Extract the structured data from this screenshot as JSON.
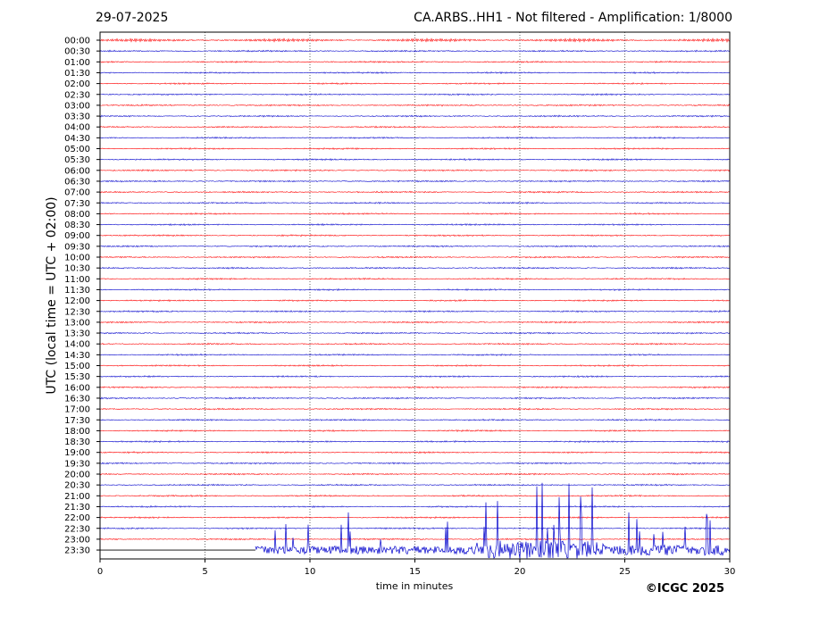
{
  "header": {
    "date": "29-07-2025",
    "title": "CA.ARBS..HH1 - Not filtered - Amplification: 1/8000"
  },
  "footer": {
    "copyright": "©ICGC 2025"
  },
  "chart_data": {
    "type": "line",
    "title": "CA.ARBS..HH1 - Not filtered - Amplification: 1/8000",
    "date": "29-07-2025",
    "xlabel": "time in minutes",
    "ylabel": "UTC (local time = UTC + 02:00)",
    "xlim": [
      0,
      30
    ],
    "x_ticks": [
      0,
      5,
      10,
      15,
      20,
      25,
      30
    ],
    "y_ticks": [
      "00:00",
      "00:30",
      "01:00",
      "01:30",
      "02:00",
      "02:30",
      "03:00",
      "03:30",
      "04:00",
      "04:30",
      "05:00",
      "05:30",
      "06:00",
      "06:30",
      "07:00",
      "07:30",
      "08:00",
      "08:30",
      "09:00",
      "09:30",
      "10:00",
      "10:30",
      "11:00",
      "11:30",
      "12:00",
      "12:30",
      "13:00",
      "13:30",
      "14:00",
      "14:30",
      "15:00",
      "15:30",
      "16:00",
      "16:30",
      "17:00",
      "17:30",
      "18:00",
      "18:30",
      "19:00",
      "19:30",
      "20:00",
      "20:30",
      "21:00",
      "21:30",
      "22:00",
      "22:30",
      "23:00",
      "23:30"
    ],
    "trace_colors": [
      "#ff0000",
      "#0000cc",
      "#000000"
    ],
    "grid": "vertical dotted lines at 5-minute intervals",
    "background_noise": "low-amplitude microseism on all 30-minute traces",
    "event": {
      "trace": "23:30",
      "onset_minute": 7.4,
      "description": "strong high-amplitude signal from about minute 7.4 to 30, largest peaks near minutes 19-23"
    }
  }
}
